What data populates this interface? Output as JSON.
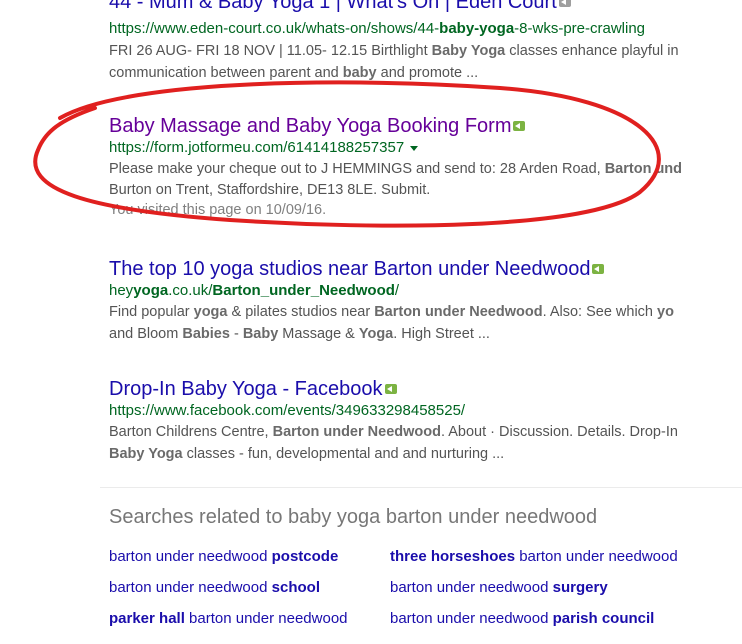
{
  "results": [
    {
      "title": "44 - Mum & Baby Yoga 1 | What's On | Eden Court",
      "url": "https://www.eden-court.co.uk/whats-on/shows/44-baby-yoga-8-wks-pre-crawling",
      "snippet_line1": "FRI 26 AUG- FRI 18 NOV | 11.05- 12.15 Birthlight Baby Yoga classes enhance playful in",
      "snippet_line2": "communication between parent and baby and promote ..."
    },
    {
      "title": "Baby Massage and Baby Yoga Booking Form",
      "url": "https://form.jotformeu.com/61414188257357",
      "snippet_line1": "Please make your cheque out to J HEMMINGS and send to: 28 Arden Road, Barton und",
      "snippet_line2": "Burton on Trent, Staffordshire, DE13 8LE. Submit.",
      "visited": "You visited this page on 10/09/16."
    },
    {
      "title": "The top 10 yoga studios near Barton under Needwood",
      "url": "heyyoga.co.uk/Barton_under_Needwood/",
      "snippet_line1": "Find popular yoga & pilates studios near Barton under Needwood. Also: See which yo",
      "snippet_line2": "and Bloom Babies - Baby Massage & Yoga. High Street ..."
    },
    {
      "title": "Drop-In Baby Yoga - Facebook",
      "url": "https://www.facebook.com/events/349633298458525/",
      "snippet_line1": "Barton Childrens Centre, Barton under Needwood. About · Discussion. Details. Drop-In",
      "snippet_line2": "Baby Yoga classes - fun, developmental and and nurturing ..."
    }
  ],
  "related": {
    "heading": "Searches related to baby yoga barton under needwood",
    "items": [
      "barton under needwood postcode",
      "three horseshoes barton under needwood",
      "barton under needwood school",
      "barton under needwood surgery",
      "parker hall barton under needwood",
      "barton under needwood parish council"
    ]
  },
  "colors": {
    "link": "#1a0dab",
    "visited_link": "#660099",
    "url": "#006621",
    "snippet": "#545454",
    "annotation_oval": "#e0201f"
  }
}
